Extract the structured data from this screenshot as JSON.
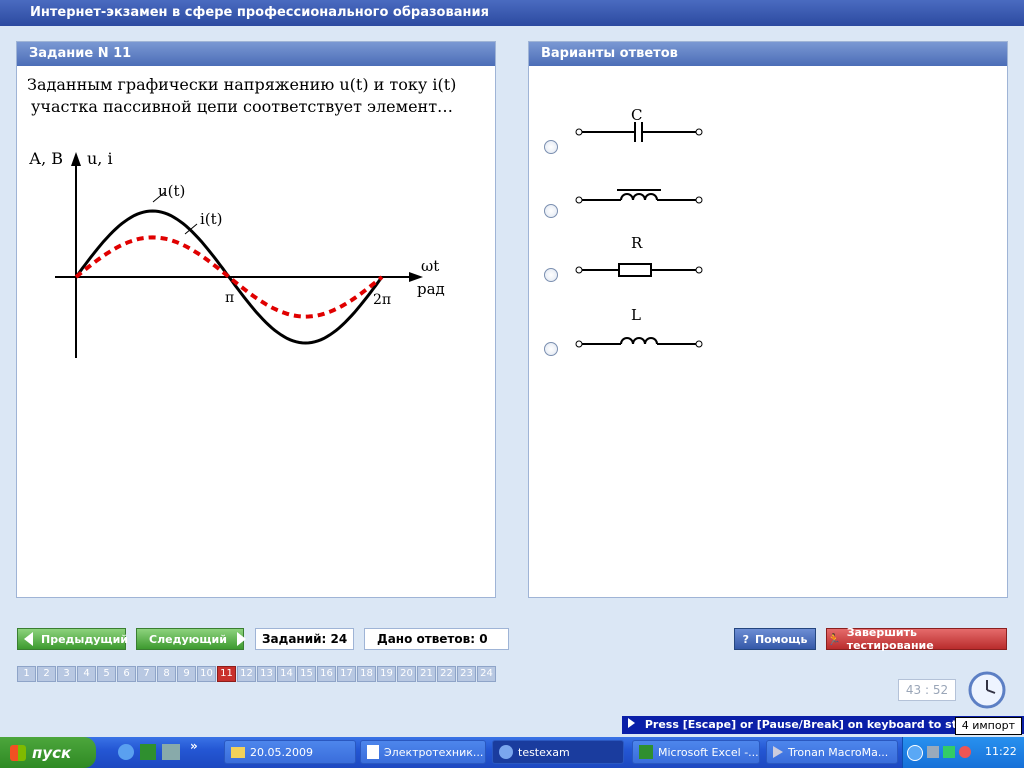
{
  "window": {
    "title": "Интернет-экзамен в сфере профессионального образования"
  },
  "question": {
    "header": "Задание N 11",
    "line1": "Заданным графически напряжению  u(t) и току  i(t)",
    "line2": "участка пассивной цепи соответствует элемент…",
    "graph": {
      "y_axis_label": "А, В",
      "y_axis_label2": "u, i",
      "x_axis_label": "ωt",
      "x_unit": "рад",
      "tick_pi": "π",
      "tick_2pi": "2π",
      "curve_u_label": "u(t)",
      "curve_i_label": "i(t)"
    }
  },
  "chart_data": {
    "type": "line",
    "x_ticks": [
      "π",
      "2π"
    ],
    "series": [
      {
        "name": "u(t)",
        "style": "solid",
        "color": "#000000",
        "amplitude": 1.0,
        "phase": 0
      },
      {
        "name": "i(t)",
        "style": "dashed",
        "color": "#e00000",
        "amplitude": 0.6,
        "phase": 0
      }
    ],
    "xlabel": "ωt",
    "ylabel": "А, В   u, i"
  },
  "answers": {
    "header": "Варианты ответов",
    "options": [
      {
        "label": "C",
        "element": "capacitor"
      },
      {
        "label": "",
        "element": "inductor-with-core"
      },
      {
        "label": "R",
        "element": "resistor"
      },
      {
        "label": "L",
        "element": "inductor"
      }
    ]
  },
  "nav": {
    "prev": "Предыдущий",
    "next": "Следующий",
    "tasks_count": "Заданий: 24",
    "answers_given": "Дано ответов: 0",
    "help": "Помощь",
    "finish": "Завершить тестирование",
    "pages": [
      "1",
      "2",
      "3",
      "4",
      "5",
      "6",
      "7",
      "8",
      "9",
      "10",
      "11",
      "12",
      "13",
      "14",
      "15",
      "16",
      "17",
      "18",
      "19",
      "20",
      "21",
      "22",
      "23",
      "24"
    ],
    "active_page": "11",
    "timer": "43 : 52"
  },
  "escape_notice": "Press [Escape] or [Pause/Break] on keyboard to stop",
  "escape_badge": "4 импорт",
  "taskbar": {
    "start": "пуск",
    "tasks": [
      "20.05.2009",
      "Электротехник...",
      "testexam",
      "Microsoft Excel -...",
      "Tronan MacroMa..."
    ],
    "clock": "11:22"
  },
  "colors": {
    "accent": "#4b6db7",
    "active_page": "#c9302c",
    "nav_green": "#3d9a2f",
    "finish_red": "#b92c2c"
  }
}
